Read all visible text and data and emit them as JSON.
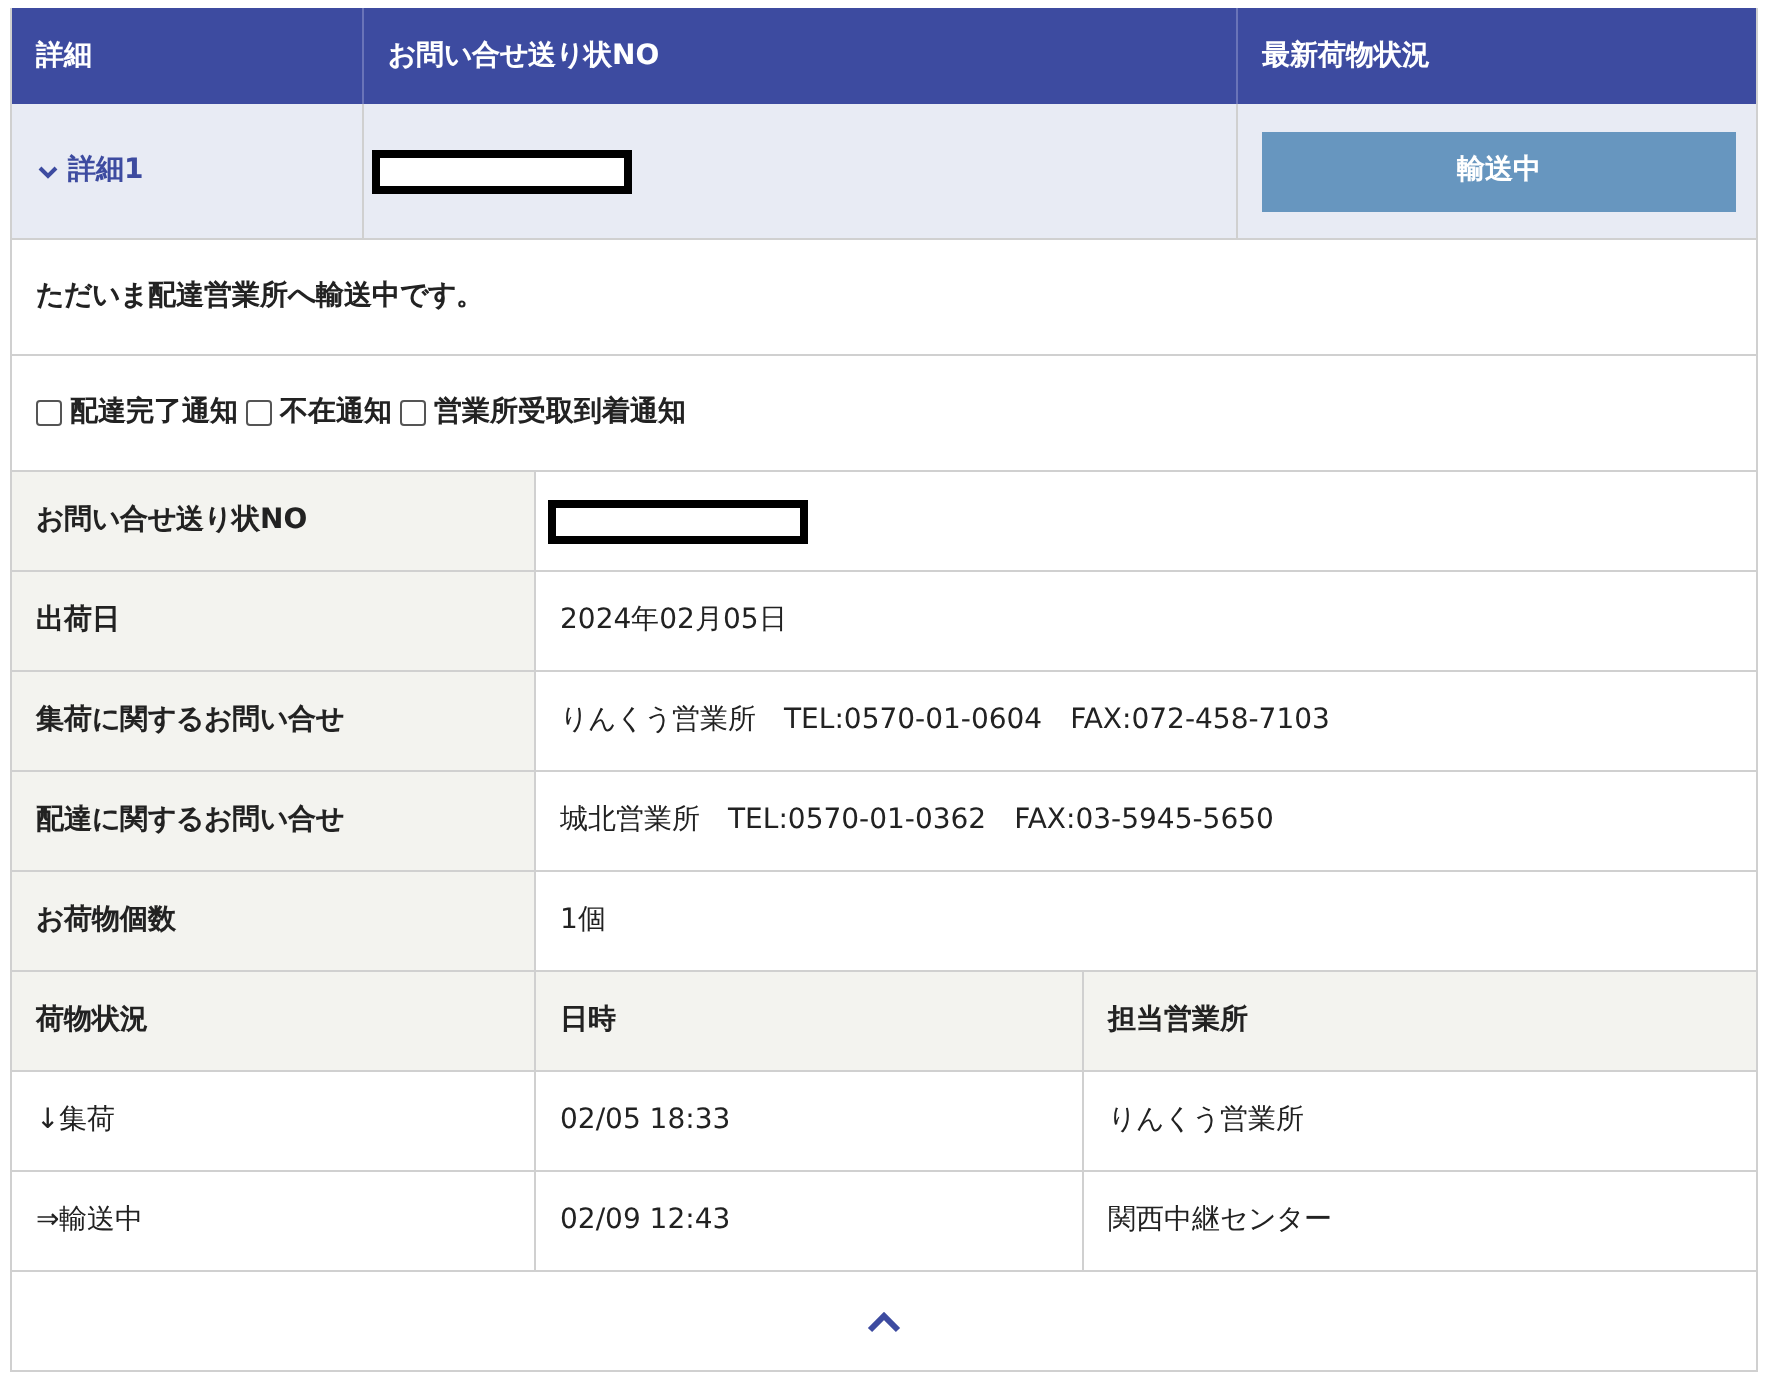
{
  "header": {
    "columns": [
      "詳細",
      "お問い合せ送り状NO",
      "最新荷物状況"
    ]
  },
  "summary": {
    "toggle": {
      "label": "詳細1",
      "expanded": true
    },
    "status_button": "輸送中"
  },
  "message": "ただいま配達営業所へ輸送中です。",
  "notifications": [
    {
      "label": "配達完了通知",
      "checked": false
    },
    {
      "label": "不在通知",
      "checked": false
    },
    {
      "label": "営業所受取到着通知",
      "checked": false
    }
  ],
  "details": [
    {
      "label": "お問い合せ送り状NO",
      "kind": "redacted"
    },
    {
      "label": "出荷日",
      "value": "2024年02月05日",
      "kind": "text"
    },
    {
      "label": "集荷に関するお問い合せ",
      "value": "りんくう営業所　TEL:0570-01-0604　FAX:072-458-7103",
      "kind": "text"
    },
    {
      "label": "配達に関するお問い合せ",
      "value": "城北営業所　TEL:0570-01-0362　FAX:03-5945-5650",
      "kind": "text"
    },
    {
      "label": "お荷物個数",
      "value": "1個",
      "kind": "text"
    }
  ],
  "history": {
    "columns": [
      "荷物状況",
      "日時",
      "担当営業所"
    ],
    "rows": [
      [
        "↓集荷",
        "02/05 18:33",
        "りんくう営業所"
      ],
      [
        "⇒輸送中",
        "02/09 12:43",
        "関西中継センター"
      ]
    ]
  }
}
